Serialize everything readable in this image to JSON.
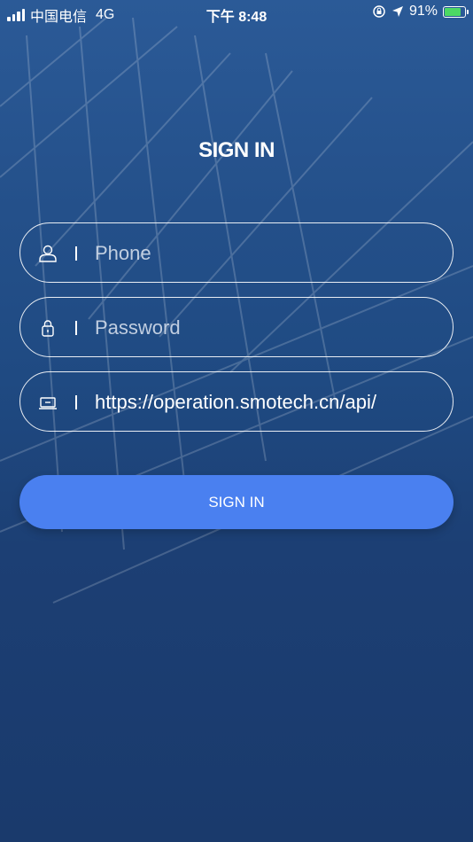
{
  "status_bar": {
    "carrier": "中国电信",
    "network": "4G",
    "time": "下午 8:48",
    "battery_percent": "91%",
    "battery_level": 0.91,
    "icons": [
      "signal-icon",
      "orientation-lock-icon",
      "location-arrow-icon",
      "battery-charging-icon"
    ]
  },
  "page": {
    "title": "SIGN IN"
  },
  "form": {
    "phone": {
      "placeholder": "Phone",
      "value": "",
      "icon": "user-icon"
    },
    "password": {
      "placeholder": "Password",
      "value": "",
      "icon": "lock-icon"
    },
    "server": {
      "placeholder": "",
      "value": "https://operation.smotech.cn/api/",
      "icon": "laptop-icon"
    },
    "submit_label": "SIGN IN"
  },
  "colors": {
    "background": "#1f4a82",
    "button": "#4a80f0",
    "battery_fill": "#4cd964"
  }
}
